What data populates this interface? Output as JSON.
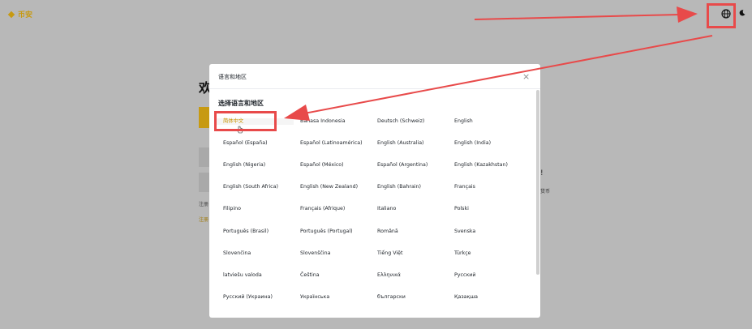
{
  "header": {
    "logo_text": "币安",
    "globe_icon": "globe-icon",
    "theme_icon": "moon-icon"
  },
  "background": {
    "heading": "欢",
    "left_text_1": "注册",
    "left_text_2": "注册",
    "right_text_1": "!",
    "right_text_2": "货币"
  },
  "modal": {
    "title": "语言和地区",
    "close_icon": "×",
    "section_label": "选择语言和地区",
    "languages": [
      [
        "简体中文",
        "Bahasa Indonesia",
        "Deutsch (Schweiz)",
        "English"
      ],
      [
        "Español (España)",
        "Español (Latinoamérica)",
        "English (Australia)",
        "English (India)"
      ],
      [
        "English (Nigeria)",
        "Español (México)",
        "Español (Argentina)",
        "English (Kazakhstan)"
      ],
      [
        "English (South Africa)",
        "English (New Zealand)",
        "English (Bahrain)",
        "Français"
      ],
      [
        "Filipino",
        "Français (Afrique)",
        "Italiano",
        "Polski"
      ],
      [
        "Português (Brasil)",
        "Português (Portugal)",
        "Română",
        "Svenska"
      ],
      [
        "Slovenčina",
        "Slovenščina",
        "Tiếng Việt",
        "Türkçe"
      ],
      [
        "latviešu valoda",
        "Čeština",
        "Ελληνικά",
        "Русский"
      ],
      [
        "Русский (Украина)",
        "Українська",
        "български",
        "Қазақша"
      ]
    ],
    "selected_language": "简体中文"
  },
  "colors": {
    "brand": "#c79a12",
    "annotation": "#e84a4a",
    "overlay": "#b8b8b8"
  }
}
